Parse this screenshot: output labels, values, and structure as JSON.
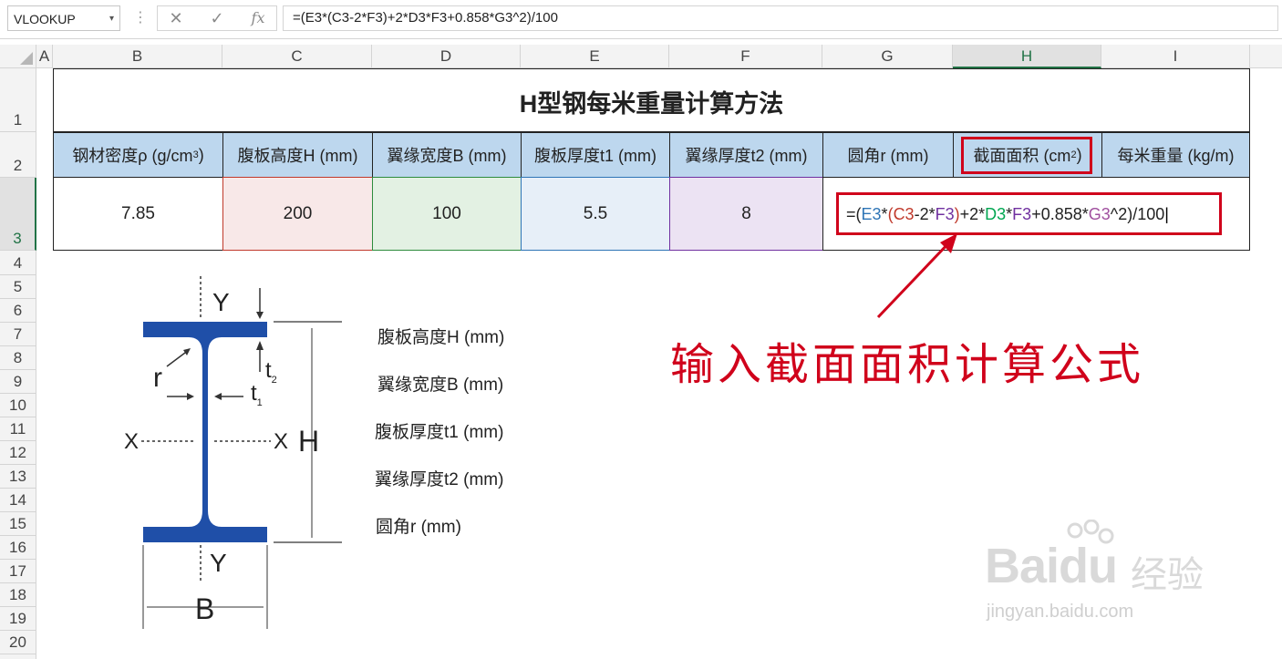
{
  "formula_bar": {
    "name_box": "VLOOKUP",
    "cancel_icon": "✕",
    "confirm_icon": "✓",
    "fx_label": "fx",
    "formula": "=(E3*(C3-2*F3)+2*D3*F3+0.858*G3^2)/100"
  },
  "columns": [
    "A",
    "B",
    "C",
    "D",
    "E",
    "F",
    "G",
    "H",
    "I"
  ],
  "rows": [
    "1",
    "2",
    "3",
    "4",
    "5",
    "6",
    "7",
    "8",
    "9",
    "10",
    "11",
    "12",
    "13",
    "14",
    "15",
    "16",
    "17",
    "18",
    "19",
    "20"
  ],
  "sheet": {
    "title": "H型钢每米重量计算方法",
    "headers": {
      "b": "钢材密度ρ (g/cm",
      "b_sup": "3",
      "b_tail": ")",
      "c": "腹板高度H (mm)",
      "d": "翼缘宽度B (mm)",
      "e": "腹板厚度t1 (mm)",
      "f": "翼缘厚度t2 (mm)",
      "g": "圆角r (mm)",
      "h": "截面面积 (cm",
      "h_sup": "2",
      "h_tail": ")",
      "i": "每米重量 (kg/m)"
    },
    "values": {
      "b": "7.85",
      "c": "200",
      "d": "100",
      "e": "5.5",
      "f": "8"
    },
    "formula_parts": [
      {
        "t": "=(",
        "c": "#222222"
      },
      {
        "t": "E3",
        "c": "#2e75b6"
      },
      {
        "t": "*",
        "c": "#222222"
      },
      {
        "t": "(",
        "c": "#c0392b"
      },
      {
        "t": "C3",
        "c": "#c0392b"
      },
      {
        "t": "-2*",
        "c": "#222222"
      },
      {
        "t": "F3",
        "c": "#7030a0"
      },
      {
        "t": ")",
        "c": "#c0392b"
      },
      {
        "t": "+2*",
        "c": "#222222"
      },
      {
        "t": "D3",
        "c": "#00a651"
      },
      {
        "t": "*",
        "c": "#222222"
      },
      {
        "t": "F3",
        "c": "#7030a0"
      },
      {
        "t": "+0.858*",
        "c": "#222222"
      },
      {
        "t": "G3",
        "c": "#a0509f"
      },
      {
        "t": "^2)/100",
        "c": "#222222"
      }
    ]
  },
  "diagram": {
    "labels": [
      "腹板高度H (mm)",
      "翼缘宽度B (mm)",
      "腹板厚度t1 (mm)",
      "翼缘厚度t2 (mm)",
      "圆角r (mm)"
    ],
    "y_top": "Y",
    "y_bottom": "Y",
    "x_left": "X",
    "x_right": "X",
    "h": "H",
    "b": "B",
    "r": "r",
    "t1": "t",
    "t1_sub": "1",
    "t2": "t",
    "t2_sub": "2"
  },
  "annotation": "输入截面面积计算公式",
  "watermark": {
    "brand": "Baidu",
    "brand_cn": "经验",
    "url": "jingyan.baidu.com"
  },
  "colors": {
    "header_fill": "#bdd7ee",
    "accent_red": "#d0021b",
    "excel_green": "#217346",
    "steel_blue": "#1f4fa8"
  }
}
